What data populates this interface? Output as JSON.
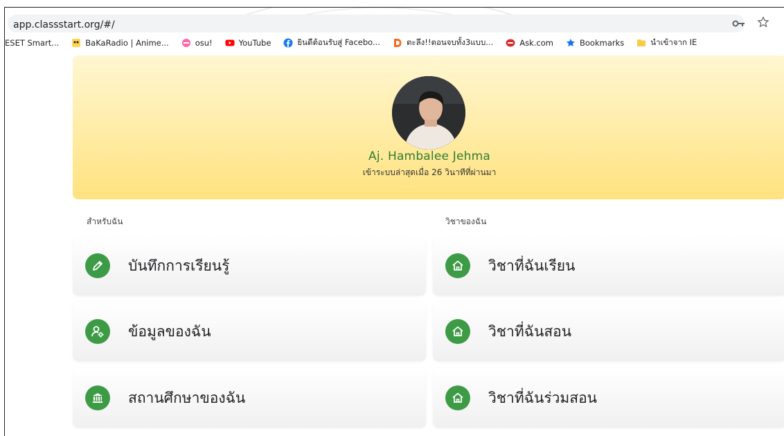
{
  "browser": {
    "url": "app.classstart.org/#/",
    "bookmarks": [
      {
        "label": "ESET Smart...",
        "icon": "none"
      },
      {
        "label": "BaKaRadio | Anime...",
        "icon": "bakaradio-icon"
      },
      {
        "label": "osu!",
        "icon": "osu-icon"
      },
      {
        "label": "YouTube",
        "icon": "youtube-icon"
      },
      {
        "label": "ยินดีต้อนรับสู่ Facebo...",
        "icon": "facebook-icon"
      },
      {
        "label": "ตะลึง!!ตอนจบทั้ง3แบบ...",
        "icon": "d-icon"
      },
      {
        "label": "Ask.com",
        "icon": "ask-icon"
      },
      {
        "label": "Bookmarks",
        "icon": "star-icon"
      },
      {
        "label": "นำเข้าจาก IE",
        "icon": "folder-icon"
      }
    ]
  },
  "profile": {
    "name": "Aj. Hambalee Jehma",
    "last_login": "เข้าระบบล่าสุดเมื่อ 26 วินาทีที่ผ่านมา"
  },
  "sections": {
    "for_me": {
      "title": "สำหรับฉัน",
      "items": [
        {
          "label": "บันทึกการเรียนรู้",
          "icon": "pencil-icon"
        },
        {
          "label": "ข้อมูลของฉัน",
          "icon": "user-settings-icon"
        },
        {
          "label": "สถานศึกษาของฉัน",
          "icon": "institution-icon"
        }
      ]
    },
    "my_courses": {
      "title": "วิชาของฉัน",
      "items": [
        {
          "label": "วิชาที่ฉันเรียน",
          "icon": "home-icon"
        },
        {
          "label": "วิชาที่ฉันสอน",
          "icon": "home-icon"
        },
        {
          "label": "วิชาที่ฉันร่วมสอน",
          "icon": "home-icon"
        }
      ]
    }
  },
  "colors": {
    "accent_green": "#3d9b46",
    "name_green": "#2e7d32",
    "banner_top": "#fff7d2",
    "banner_bottom": "#ffe27f"
  }
}
